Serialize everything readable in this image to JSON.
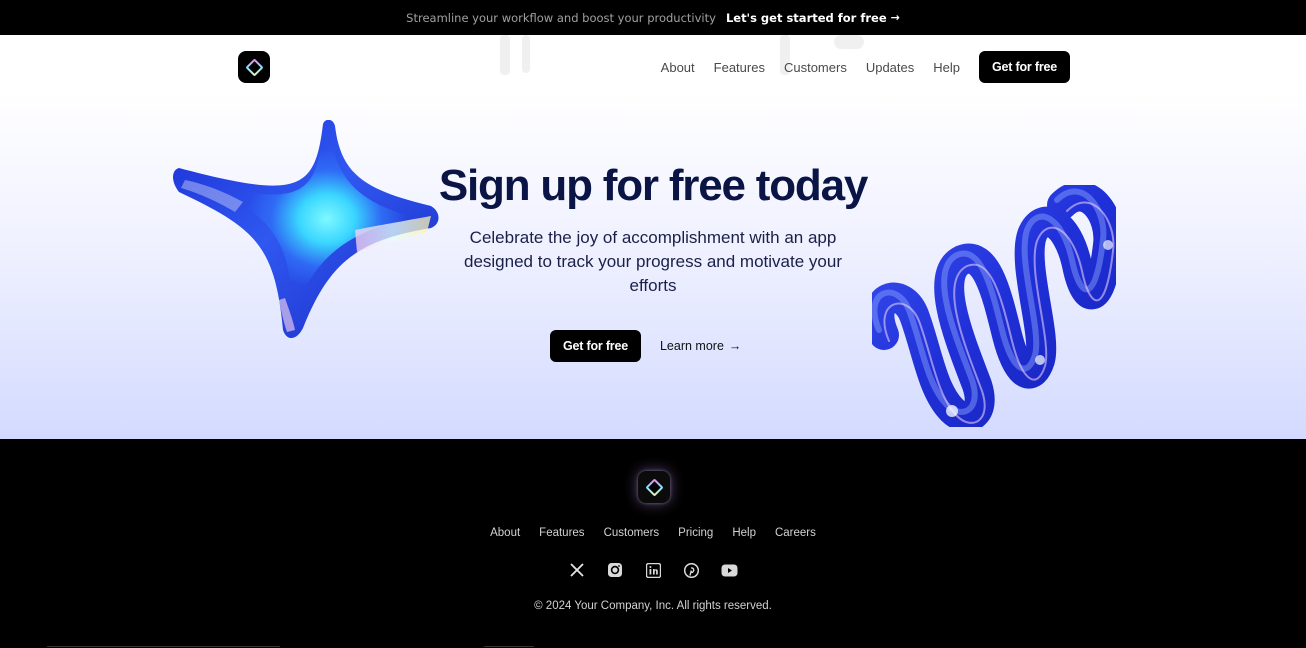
{
  "announcement": {
    "text": "Streamline your workflow and boost your productivity",
    "cta_label": "Let's get started for free",
    "arrow": "→"
  },
  "nav": {
    "links": [
      "About",
      "Features",
      "Customers",
      "Updates",
      "Help"
    ],
    "cta_label": "Get for free"
  },
  "hero": {
    "title": "Sign up for free today",
    "subtitle": "Celebrate the joy of accomplishment with an app designed to track your progress and motivate your efforts",
    "primary_cta": "Get for free",
    "secondary_cta": "Learn more",
    "secondary_arrow": "→"
  },
  "footer": {
    "links": [
      "About",
      "Features",
      "Customers",
      "Pricing",
      "Help",
      "Careers"
    ],
    "socials": [
      "x-icon",
      "instagram-icon",
      "linkedin-icon",
      "pinterest-icon",
      "youtube-icon"
    ],
    "copyright": "© 2024 Your Company, Inc. All rights reserved."
  },
  "colors": {
    "brand_dark": "#000000",
    "headline": "#0a1445",
    "accent_blue": "#2233d6",
    "hero_gradient_bottom": "#d3daff"
  }
}
